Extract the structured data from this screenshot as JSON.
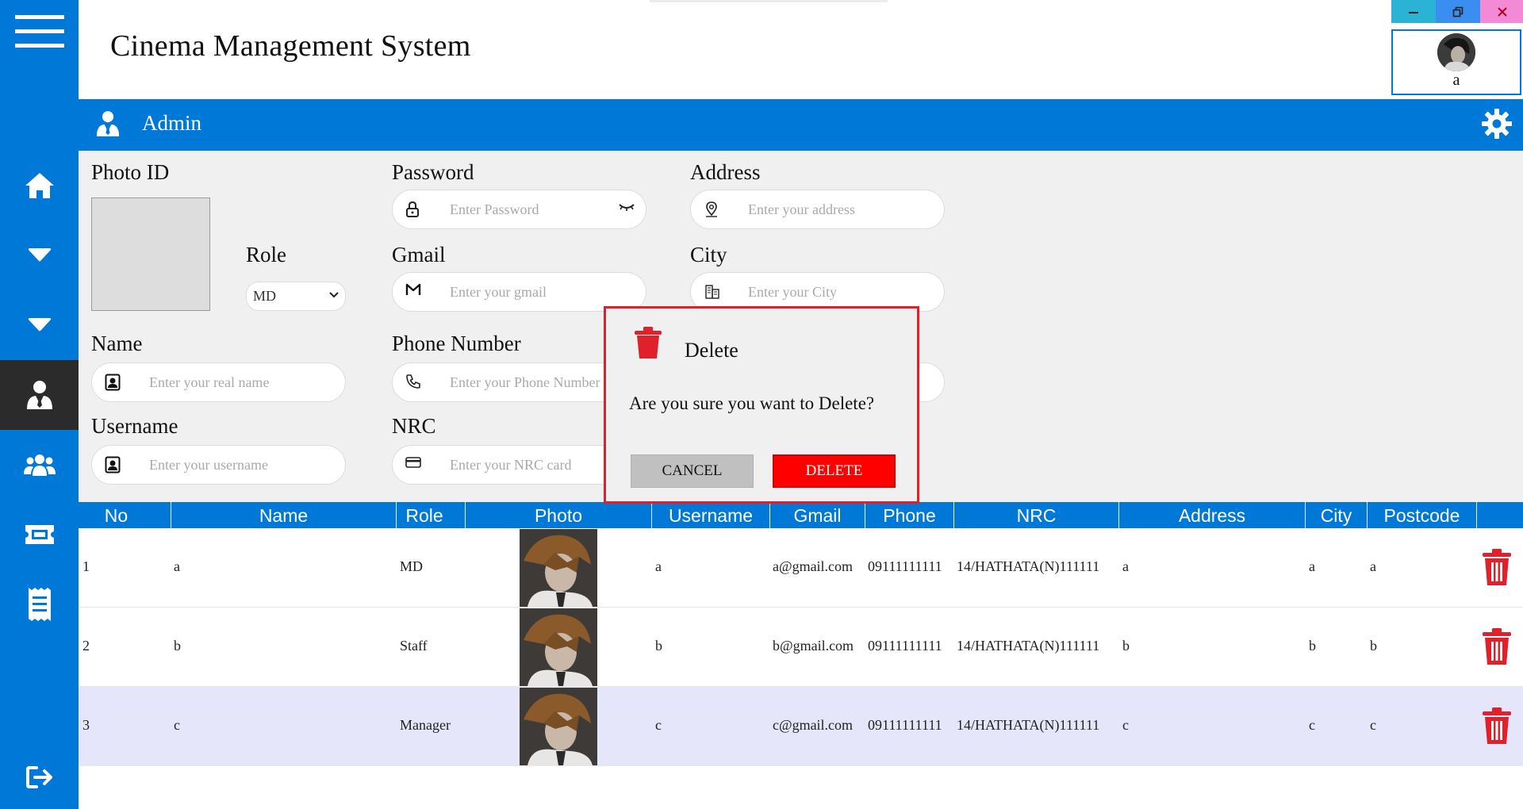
{
  "app": {
    "title": "Cinema Management System"
  },
  "window_controls": [
    {
      "name": "minimize-button",
      "color": "#2bb3d6",
      "icon": "minimize-icon"
    },
    {
      "name": "restore-button",
      "color": "#3a8ef0",
      "icon": "restore-icon"
    },
    {
      "name": "close-button",
      "color": "#f28ad6",
      "icon": "close-icon"
    }
  ],
  "user": {
    "name": "a"
  },
  "section": {
    "title": "Admin"
  },
  "sidebar": {
    "items": [
      {
        "name": "sidebar-item-menu",
        "icon": "hamburger-menu-icon"
      },
      {
        "name": "sidebar-item-home",
        "icon": "home-icon"
      },
      {
        "name": "sidebar-item-dropdown-1",
        "icon": "caret-down-icon"
      },
      {
        "name": "sidebar-item-dropdown-2",
        "icon": "caret-down-icon"
      },
      {
        "name": "sidebar-item-admin",
        "icon": "user-tie-icon",
        "active": true
      },
      {
        "name": "sidebar-item-customers",
        "icon": "users-group-icon"
      },
      {
        "name": "sidebar-item-tickets",
        "icon": "ticket-icon"
      },
      {
        "name": "sidebar-item-receipts",
        "icon": "receipt-icon"
      },
      {
        "name": "sidebar-item-logout",
        "icon": "logout-icon"
      }
    ]
  },
  "form": {
    "photo_label": "Photo ID",
    "role_label": "Role",
    "role_value": "MD",
    "name_label": "Name",
    "name_placeholder": "Enter your real name",
    "username_label": "Username",
    "username_placeholder": "Enter your username",
    "password_label": "Password",
    "password_placeholder": "Enter Password",
    "gmail_label": "Gmail",
    "gmail_placeholder": "Enter your gmail",
    "phone_label": "Phone Number",
    "phone_placeholder": "Enter your Phone Number",
    "nrc_label": "NRC",
    "nrc_placeholder": "Enter your NRC card",
    "address_label": "Address",
    "address_placeholder": "Enter your address",
    "city_label": "City",
    "city_placeholder": "Enter your City"
  },
  "table": {
    "columns": [
      "No",
      "Name",
      "Role",
      "Photo",
      "Username",
      "Gmail",
      "Phone",
      "NRC",
      "Address",
      "City",
      "Postcode"
    ],
    "rows": [
      {
        "no": "1",
        "name": "a",
        "role": "MD",
        "username": "a",
        "gmail": "a@gmail.com",
        "phone": "09111111111",
        "nrc": "14/HATHATA(N)111111",
        "address": "a",
        "city": "a",
        "postcode": "a"
      },
      {
        "no": "2",
        "name": "b",
        "role": "Staff",
        "username": "b",
        "gmail": "b@gmail.com",
        "phone": "09111111111",
        "nrc": "14/HATHATA(N)111111",
        "address": "b",
        "city": "b",
        "postcode": "b"
      },
      {
        "no": "3",
        "name": "c",
        "role": "Manager",
        "username": "c",
        "gmail": "c@gmail.com",
        "phone": "09111111111",
        "nrc": "14/HATHATA(N)111111",
        "address": "c",
        "city": "c",
        "postcode": "c",
        "selected": true
      }
    ]
  },
  "dialog": {
    "title": "Delete",
    "message": "Are you sure you want to Delete?",
    "cancel_label": "CANCEL",
    "delete_label": "DELETE"
  },
  "colors": {
    "primary": "#0078d7",
    "sidebar_active": "#2b2b2b",
    "danger": "#e0202a",
    "selected_row": "#e6e6fa"
  }
}
